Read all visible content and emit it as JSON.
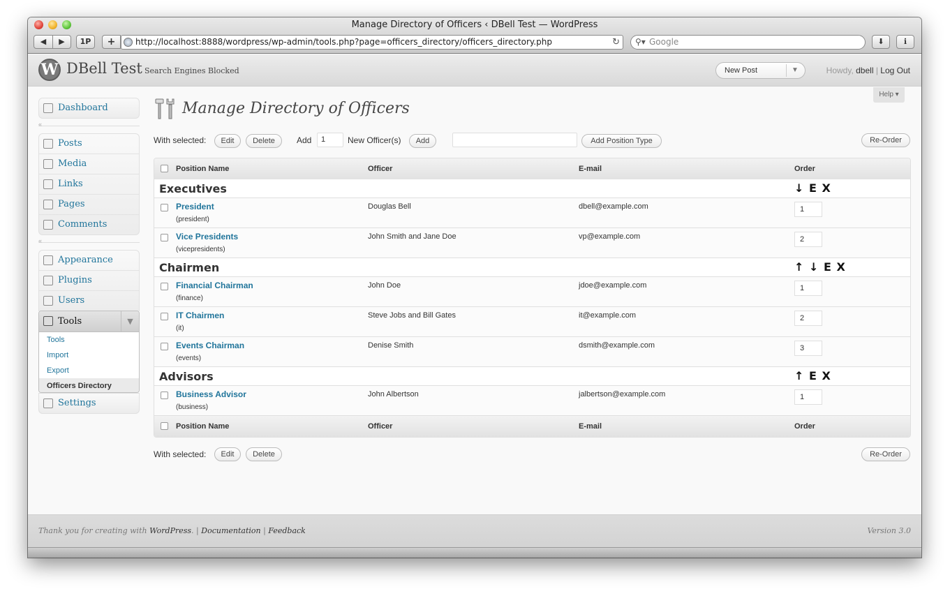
{
  "browser": {
    "window_title": "Manage Directory of Officers ‹ DBell Test — WordPress",
    "url": "http://localhost:8888/wordpress/wp-admin/tools.php?page=officers_directory/officers_directory.php",
    "search_placeholder": "Google",
    "back_glyph": "◀",
    "forward_glyph": "▶",
    "onep_label": "1P",
    "add_tab_glyph": "+",
    "reload_glyph": "↻",
    "download_glyph": "⬇",
    "info_glyph": "ℹ"
  },
  "header": {
    "logo_letter": "W",
    "site_name": "DBell Test",
    "search_engines_blocked": "Search Engines Blocked",
    "new_post": "New Post",
    "howdy": "Howdy,",
    "username": "dbell",
    "separator": "|",
    "logout": "Log Out"
  },
  "sidebar": {
    "group1": [
      "Dashboard"
    ],
    "group2": [
      "Posts",
      "Media",
      "Links",
      "Pages",
      "Comments"
    ],
    "group3": [
      "Appearance",
      "Plugins",
      "Users"
    ],
    "tools": {
      "label": "Tools",
      "submenu": [
        "Tools",
        "Import",
        "Export",
        "Officers Directory"
      ]
    },
    "settings": "Settings"
  },
  "main": {
    "help": "Help ▾",
    "title": "Manage Directory of Officers",
    "toolbar": {
      "with_selected": "With selected:",
      "edit": "Edit",
      "delete": "Delete",
      "add_label": "Add",
      "add_count": "1",
      "new_officers": "New Officer(s)",
      "add_button": "Add",
      "position_type_value": "",
      "add_position_type": "Add Position Type",
      "reorder": "Re-Order"
    },
    "columns": [
      "Position Name",
      "Officer",
      "E-mail",
      "Order"
    ],
    "groups": [
      {
        "name": "Executives",
        "actions": "↓ E X",
        "rows": [
          {
            "position": "President",
            "slug": "(president)",
            "officer": "Douglas Bell",
            "email": "dbell@example.com",
            "order": "1"
          },
          {
            "position": "Vice Presidents",
            "slug": "(vicepresidents)",
            "officer": "John Smith and Jane Doe",
            "email": "vp@example.com",
            "order": "2"
          }
        ]
      },
      {
        "name": "Chairmen",
        "actions": "↑ ↓ E X",
        "rows": [
          {
            "position": "Financial Chairman",
            "slug": "(finance)",
            "officer": "John Doe",
            "email": "jdoe@example.com",
            "order": "1"
          },
          {
            "position": "IT Chairmen",
            "slug": "(it)",
            "officer": "Steve Jobs and Bill Gates",
            "email": "it@example.com",
            "order": "2"
          },
          {
            "position": "Events Chairman",
            "slug": "(events)",
            "officer": "Denise Smith",
            "email": "dsmith@example.com",
            "order": "3"
          }
        ]
      },
      {
        "name": "Advisors",
        "actions": "↑ E X",
        "rows": [
          {
            "position": "Business Advisor",
            "slug": "(business)",
            "officer": "John Albertson",
            "email": "jalbertson@example.com",
            "order": "1"
          }
        ]
      }
    ]
  },
  "footer": {
    "thank_you": "Thank you for creating with",
    "wordpress": "WordPress",
    "documentation": "Documentation",
    "feedback": "Feedback",
    "separator": "|",
    "version": "Version 3.0"
  }
}
